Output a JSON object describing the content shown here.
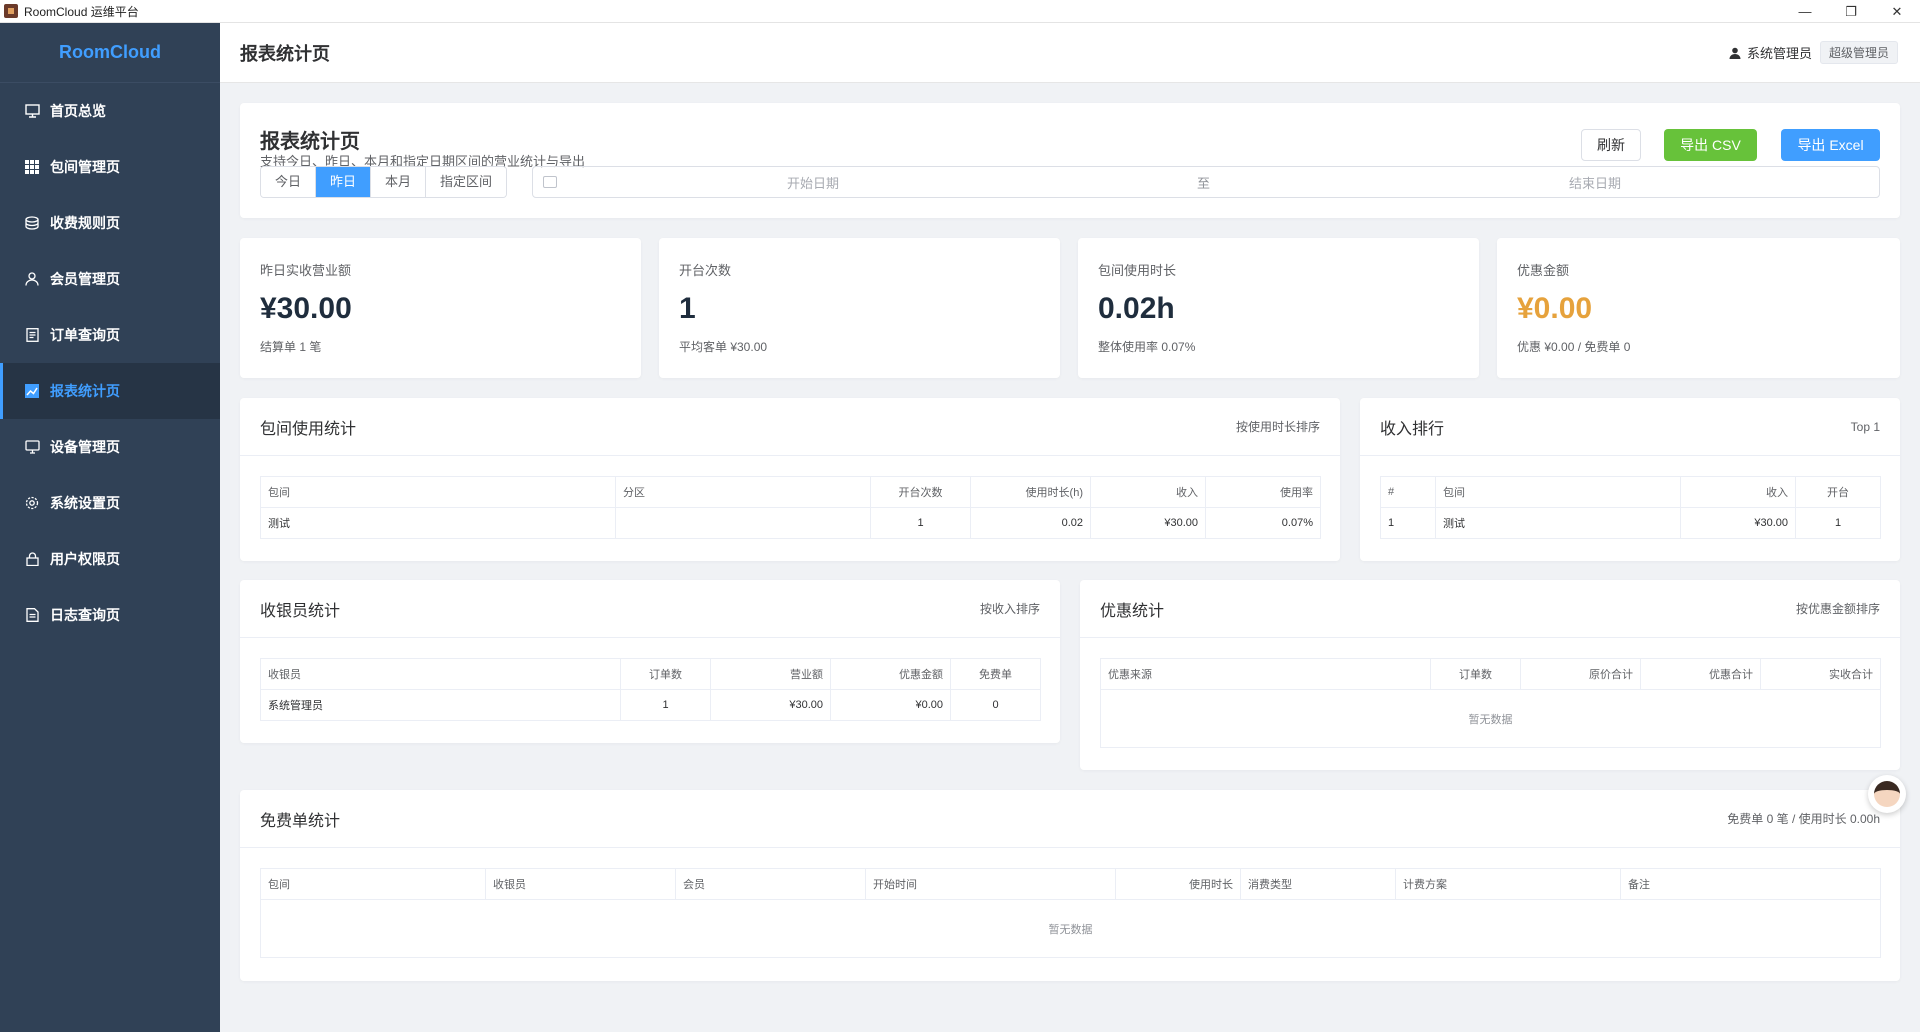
{
  "window": {
    "title": "RoomCloud 运维平台",
    "controls": [
      "—",
      "❐",
      "✕"
    ]
  },
  "sidebar": {
    "brand": "RoomCloud",
    "items": [
      {
        "label": "首页总览",
        "icon": "dashboard-icon"
      },
      {
        "label": "包间管理页",
        "icon": "grid-icon"
      },
      {
        "label": "收费规则页",
        "icon": "coins-icon"
      },
      {
        "label": "会员管理页",
        "icon": "user-icon"
      },
      {
        "label": "订单查询页",
        "icon": "document-icon"
      },
      {
        "label": "报表统计页",
        "icon": "chart-icon",
        "active": true
      },
      {
        "label": "设备管理页",
        "icon": "monitor-icon"
      },
      {
        "label": "系统设置页",
        "icon": "gear-icon"
      },
      {
        "label": "用户权限页",
        "icon": "lock-icon"
      },
      {
        "label": "日志查询页",
        "icon": "log-icon"
      }
    ]
  },
  "header": {
    "title": "报表统计页",
    "user_name": "系统管理员",
    "role": "超级管理员"
  },
  "toolbar": {
    "title": "报表统计页",
    "subtitle": "支持今日、昨日、本月和指定日期区间的营业统计与导出",
    "ranges": [
      "今日",
      "昨日",
      "本月",
      "指定区间"
    ],
    "active_range": "昨日",
    "date_start_placeholder": "开始日期",
    "date_sep": "至",
    "date_end_placeholder": "结束日期",
    "refresh": "刷新",
    "export_csv": "导出 CSV",
    "export_excel": "导出 Excel"
  },
  "stats": [
    {
      "label": "昨日实收营业额",
      "value": "¥30.00",
      "foot": "结算单 1 笔"
    },
    {
      "label": "开台次数",
      "value": "1",
      "foot": "平均客单 ¥30.00"
    },
    {
      "label": "包间使用时长",
      "value": "0.02h",
      "foot": "整体使用率 0.07%"
    },
    {
      "label": "优惠金额",
      "value": "¥0.00",
      "foot": "优惠 ¥0.00 / 免费单 0",
      "color": "#e6a23c"
    }
  ],
  "room_usage": {
    "title": "包间使用统计",
    "sort": "按使用时长排序",
    "columns": [
      "包间",
      "分区",
      "开台次数",
      "使用时长(h)",
      "收入",
      "使用率"
    ],
    "rows": [
      [
        "测试",
        "",
        "1",
        "0.02",
        "¥30.00",
        "0.07%"
      ]
    ]
  },
  "income_rank": {
    "title": "收入排行",
    "top": "Top 1",
    "columns": [
      "#",
      "包间",
      "收入",
      "开台"
    ],
    "rows": [
      [
        "1",
        "测试",
        "¥30.00",
        "1"
      ]
    ]
  },
  "cashier": {
    "title": "收银员统计",
    "sort": "按收入排序",
    "columns": [
      "收银员",
      "订单数",
      "营业额",
      "优惠金额",
      "免费单"
    ],
    "rows": [
      [
        "系统管理员",
        "1",
        "¥30.00",
        "¥0.00",
        "0"
      ]
    ]
  },
  "discount": {
    "title": "优惠统计",
    "sort": "按优惠金额排序",
    "columns": [
      "优惠来源",
      "订单数",
      "原价合计",
      "优惠合计",
      "实收合计"
    ],
    "empty": "暂无数据"
  },
  "free_orders": {
    "title": "免费单统计",
    "summary": "免费单 0 笔 / 使用时长 0.00h",
    "columns": [
      "包间",
      "收银员",
      "会员",
      "开始时间",
      "使用时长",
      "消费类型",
      "计费方案",
      "备注"
    ],
    "empty": "暂无数据"
  }
}
